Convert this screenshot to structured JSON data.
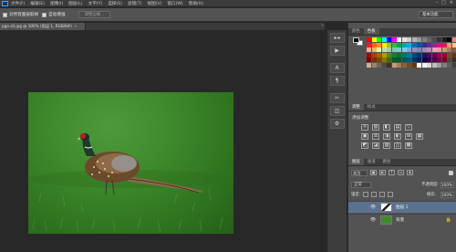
{
  "menubar": {
    "items": [
      "文件(F)",
      "编辑(E)",
      "图像(I)",
      "图层(L)",
      "文字(Y)",
      "选择(S)",
      "滤镜(T)",
      "视图(V)",
      "窗口(W)",
      "帮助(H)"
    ],
    "window_controls": [
      "–",
      "□",
      "×"
    ]
  },
  "options": {
    "left_text": "对所有图层取样",
    "auto_enhance_label": "自动增强",
    "refine_edge_label": "调整边缘...",
    "workspace_label": "基本功能"
  },
  "document": {
    "tab_title": "pge.s0.jpg @ 100% (图层 1, RGB/8#)",
    "tab_close": "×"
  },
  "panels": {
    "swatch_tabs": [
      "颜色",
      "色板"
    ],
    "swatch_colors": [
      "#ff0000",
      "#ffff00",
      "#00ff00",
      "#00ffff",
      "#0000ff",
      "#ff00ff",
      "#ffffff",
      "#e6e6e6",
      "#cccccc",
      "#b3b3b3",
      "#999999",
      "#808080",
      "#666666",
      "#4d4d4d",
      "#333333",
      "#1a1a1a",
      "#000000",
      "#ff8080",
      "#ed1c24",
      "#f26522",
      "#f7941d",
      "#fff200",
      "#8dc63f",
      "#39b54a",
      "#00a651",
      "#00a99d",
      "#00aeef",
      "#0072bc",
      "#0054a6",
      "#2e3192",
      "#662d91",
      "#92278f",
      "#ec008c",
      "#ed145b",
      "#f69679",
      "#fdc689",
      "#f9ad81",
      "#fbaf5d",
      "#fff799",
      "#c4df9b",
      "#a3d39c",
      "#82ca9c",
      "#7accc8",
      "#6dcff6",
      "#7da7d9",
      "#8393ca",
      "#8781bd",
      "#a186be",
      "#bd8cbf",
      "#f49ac1",
      "#f5989d",
      "#c69c6d",
      "#a67c52",
      "#8c6239",
      "#9e0b0f",
      "#a0410d",
      "#a36209",
      "#aba000",
      "#598527",
      "#1a7b30",
      "#007236",
      "#00746b",
      "#0076a3",
      "#004a80",
      "#003471",
      "#1b1464",
      "#440e62",
      "#630460",
      "#9e005d",
      "#9e0039",
      "#754c24",
      "#603913",
      "#790000",
      "#7b2e00",
      "#7d4900",
      "#827b00",
      "#406618",
      "#005e20",
      "#005826",
      "#005952",
      "#005b7f",
      "#003663",
      "#002157",
      "#0d004c",
      "#32004b",
      "#4b0049",
      "#7b0046",
      "#7a0026",
      "#534741",
      "#362f2d",
      "#c7b299",
      "#998675",
      "#736357",
      "#534741",
      "#37302a",
      "#c69c6d",
      "#a67c52",
      "#8c6239",
      "#754c24",
      "#603913",
      "#ffffff",
      "#f2f2f2",
      "#dcdcdc",
      "#bfbfbf",
      "#a0a0a0",
      "#7f7f7f",
      "#5f5f5f",
      "#3f3f3f"
    ],
    "adjust_tabs": [
      "调整",
      "样式"
    ],
    "adjust_title": "添加调整",
    "adjust_row1": [
      "☼",
      "▥",
      "◧",
      "▤",
      "▽"
    ],
    "adjust_row2": [
      "▣",
      "⚖",
      "◑",
      "◐",
      "⊞",
      "▦"
    ],
    "adjust_row3": [
      "◩",
      "◪",
      "▨",
      "◫",
      "▩"
    ],
    "layer_tabs": [
      "图层",
      "通道",
      "路径"
    ],
    "kind_label": "类型",
    "filter_icons": [
      "▣",
      "◐",
      "T",
      "▭",
      "◈"
    ],
    "blend_mode": "正常",
    "opacity_label": "不透明度:",
    "opacity_value": "100%",
    "lock_label": "锁定:",
    "fill_label": "填充:",
    "fill_value": "100%",
    "layers": [
      {
        "name": "图层 1",
        "selected": true
      },
      {
        "name": "背景",
        "selected": false
      }
    ],
    "background_lock": "🔒"
  },
  "tools": {
    "icons": [
      "▸◂",
      "▶",
      "A",
      "¶",
      "✂",
      "◫",
      "⚙"
    ]
  }
}
